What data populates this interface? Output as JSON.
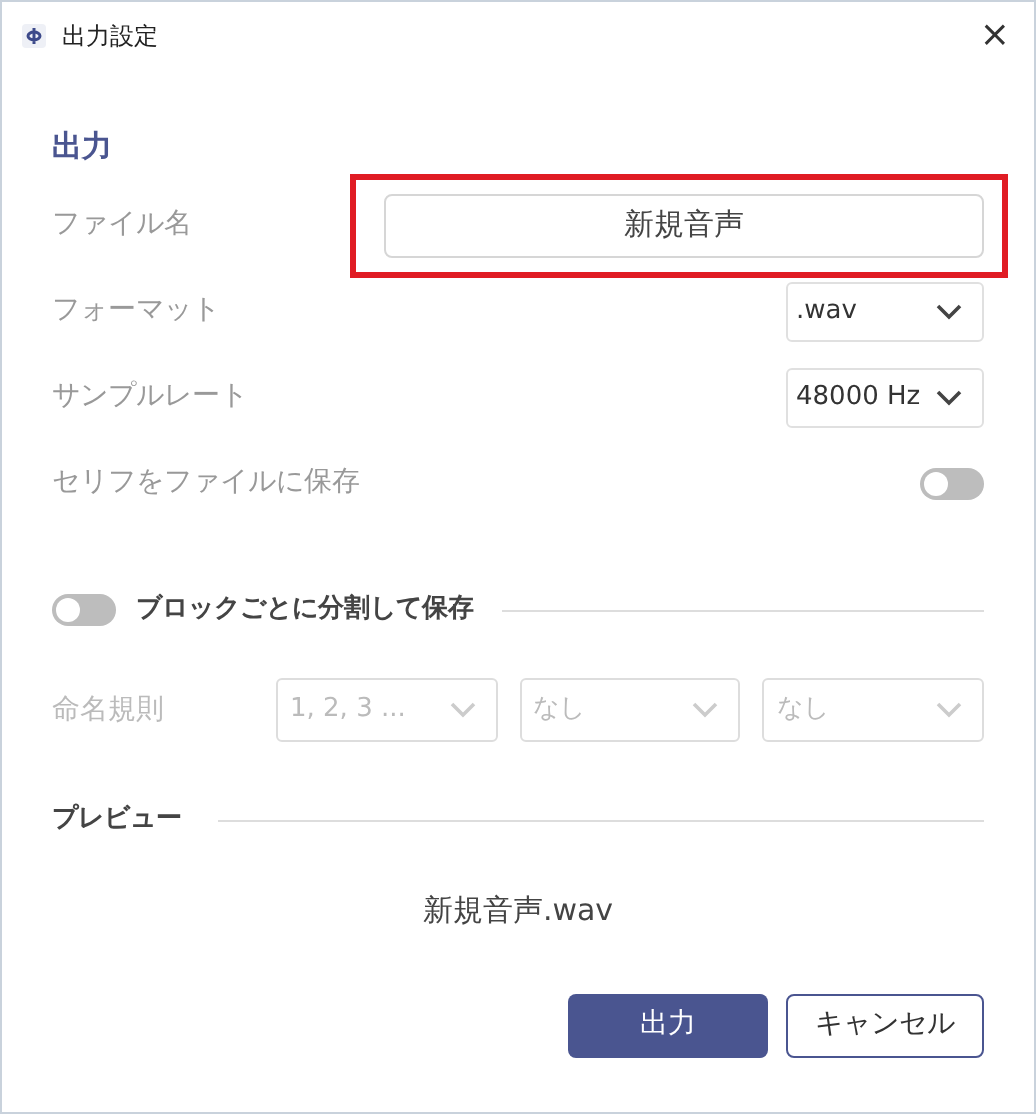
{
  "window": {
    "title": "出力設定",
    "close": "×"
  },
  "section_title": "出力",
  "settings": [
    {
      "kind": "text",
      "label": "ファイル名",
      "value": "新規音声",
      "highlighted": true
    },
    {
      "kind": "select",
      "label": "フォーマット",
      "value": ".wav"
    },
    {
      "kind": "select",
      "label": "サンプルレート",
      "value": "48000 Hz"
    },
    {
      "kind": "toggle",
      "label": "セリフをファイルに保存",
      "on": false
    }
  ],
  "split": {
    "label": "ブロックごとに分割して保存",
    "on": false
  },
  "naming": {
    "label": "命名規則",
    "disabled": true,
    "options": [
      "1, 2, 3 ...",
      "なし",
      "なし"
    ]
  },
  "preview": {
    "title": "プレビュー",
    "text": "新規音声.wav"
  },
  "buttons": [
    {
      "label": "出力",
      "primary": true
    },
    {
      "label": "キャンセル",
      "primary": false
    }
  ]
}
